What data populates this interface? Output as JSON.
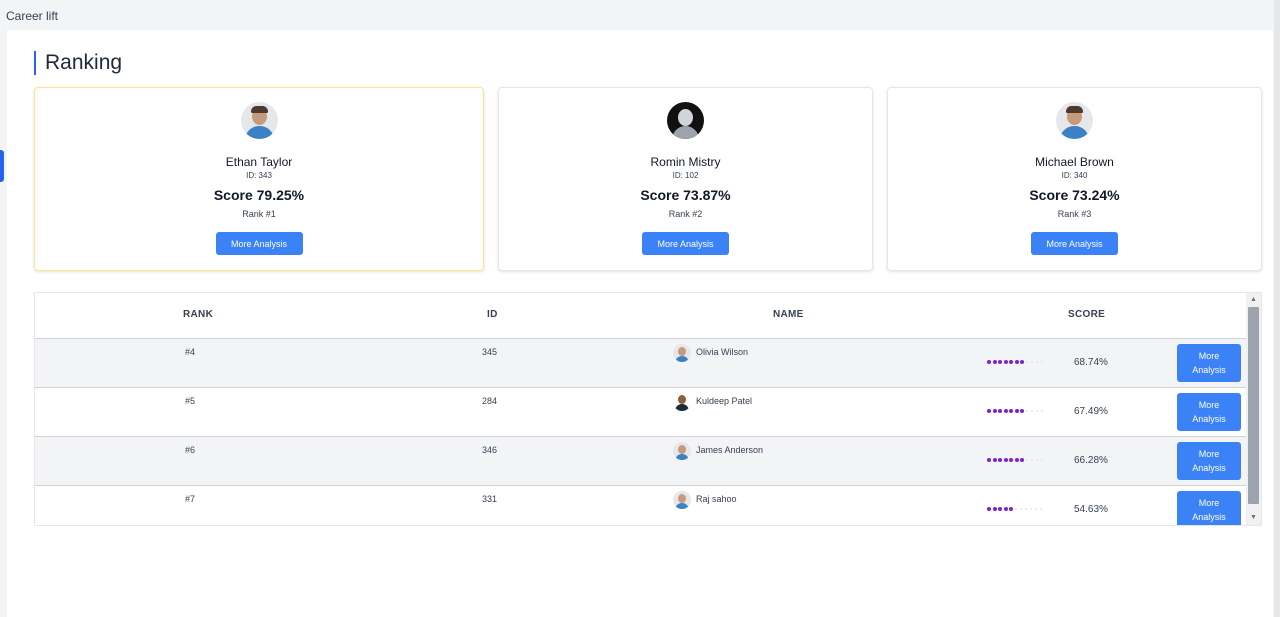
{
  "app": {
    "title": "Career lift"
  },
  "page": {
    "heading": "Ranking"
  },
  "top_cards": [
    {
      "name": "Ethan Taylor",
      "id": "ID: 343",
      "score": "Score 79.25%",
      "rank": "Rank #1",
      "button": "More Analysis",
      "avatar": "man-photo-avatar"
    },
    {
      "name": "Romin Mistry",
      "id": "ID: 102",
      "score": "Score 73.87%",
      "rank": "Rank #2",
      "button": "More Analysis",
      "avatar": "dark-photo-avatar"
    },
    {
      "name": "Michael Brown",
      "id": "ID: 340",
      "score": "Score 73.24%",
      "rank": "Rank #3",
      "button": "More Analysis",
      "avatar": "man-photo-avatar"
    }
  ],
  "table": {
    "headers": {
      "rank": "RANK",
      "id": "ID",
      "name": "NAME",
      "score": "SCORE"
    },
    "rows": [
      {
        "rank": "#4",
        "id": "345",
        "name": "Olivia Wilson",
        "score": "68.74%",
        "score_value": 0.6874,
        "button": "More Analysis"
      },
      {
        "rank": "#5",
        "id": "284",
        "name": "Kuldeep Patel",
        "score": "67.49%",
        "score_value": 0.6749,
        "button": "More Analysis"
      },
      {
        "rank": "#6",
        "id": "346",
        "name": "James Anderson",
        "score": "66.28%",
        "score_value": 0.6628,
        "button": "More Analysis"
      },
      {
        "rank": "#7",
        "id": "331",
        "name": "Raj sahoo",
        "score": "54.63%",
        "score_value": 0.5463,
        "button": "More Analysis"
      }
    ]
  },
  "colors": {
    "accent": "#3b82f6",
    "progress": "#7e22ce",
    "heading_bar": "#2563eb"
  }
}
